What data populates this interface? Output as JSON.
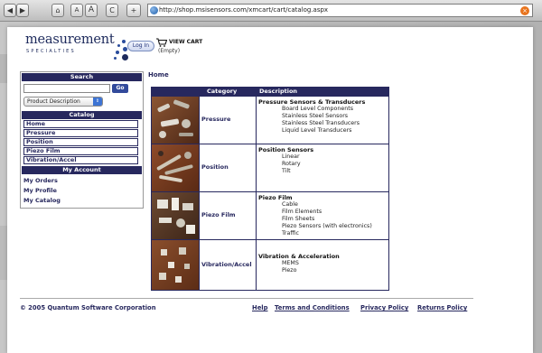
{
  "browser": {
    "url": "http://shop.msisensors.com/xmcart/cart/catalog.aspx",
    "buttons": [
      {
        "name": "back-button",
        "glyph": "◀"
      },
      {
        "name": "forward-button",
        "glyph": "▶"
      },
      {
        "name": "home-button",
        "glyph": "⌂"
      },
      {
        "name": "text-smaller-button",
        "glyph": "A"
      },
      {
        "name": "text-larger-button",
        "glyph": "A"
      },
      {
        "name": "reload-button",
        "glyph": "C"
      },
      {
        "name": "add-bookmark-button",
        "glyph": "+"
      }
    ],
    "stop_glyph": "×"
  },
  "header": {
    "logo_main": "measurement",
    "logo_sub": "SPECIALTIES",
    "login_label": "Log In",
    "cart_label": "VIEW CART",
    "cart_status": "(Empty)"
  },
  "sidebar": {
    "search_heading": "Search",
    "search_value": "",
    "go_label": "Go",
    "search_type": "Product Description",
    "catalog_heading": "Catalog",
    "catalog_items": [
      "Home",
      "Pressure",
      "Position",
      "Piezo Film",
      "Vibration/Accel"
    ],
    "account_heading": "My Account",
    "account_items": [
      "My Orders",
      "My Profile",
      "My Catalog"
    ]
  },
  "main": {
    "breadcrumb": "Home",
    "columns": [
      "Category",
      "Description"
    ],
    "rows": [
      {
        "category": "Pressure",
        "title": "Pressure Sensors & Transducers",
        "items": [
          "Board Level Components",
          "Stainless Steel Sensors",
          "Stainless Steel Transducers",
          "Liquid Level Transducers"
        ]
      },
      {
        "category": "Position",
        "title": "Position Sensors",
        "items": [
          "Linear",
          "Rotary",
          "Tilt"
        ]
      },
      {
        "category": "Piezo Film",
        "title": "Piezo Film",
        "items": [
          "Cable",
          "Film Elements",
          "Film Sheets",
          "Piezo Sensors (with electronics)",
          "Traffic"
        ]
      },
      {
        "category": "Vibration/Accel",
        "title": "Vibration & Acceleration",
        "items": [
          "MEMS",
          "Piezo"
        ]
      }
    ]
  },
  "footer": {
    "copyright": "© 2005 Quantum Software Corporation",
    "links": [
      "Help",
      "Terms and Conditions",
      "Privacy Policy",
      "Returns Policy"
    ]
  },
  "colors": {
    "navy": "#27285e",
    "product_photo_bg": "#7a4428",
    "stop_button": "#e8741e"
  }
}
